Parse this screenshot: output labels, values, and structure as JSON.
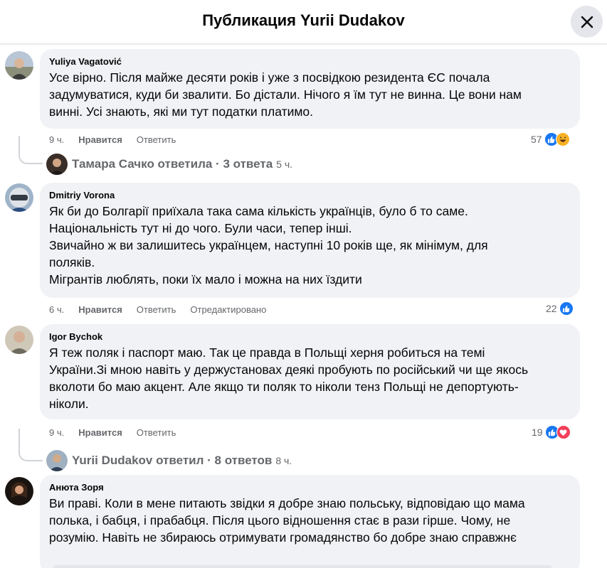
{
  "header": {
    "title": "Публикация Yurii Dudakov",
    "close_icon": "close-icon"
  },
  "comments": [
    {
      "author": "Yuliya Vagatović",
      "text": "Усе вірно. Після майже десяти років і уже з посвідкою резидента ЄС почала\nзадумуватися, куди би звалити. Бо дістали. Нічого я їм тут не винна. Це вони нам\nвинні. Усі знають, які ми тут податки платимо.",
      "time": "9 ч.",
      "like_label": "Нравится",
      "reply_label": "Ответить",
      "edited_label": "",
      "reactions_count": "57",
      "reactions": [
        "like",
        "haha"
      ],
      "replies_summary": "Тамара Сачко ответила · 3 ответа",
      "replies_time": "5 ч."
    },
    {
      "author": "Dmitriy Vorona",
      "text": "Як би до Болгарії приїхала така сама кількість українців, було б то саме.\nНаціональність тут ні до чого. Були часи, тепер інші.\nЗвичайно ж ви залишитесь українцем, наступні 10 років ще, як мінімум, для\nполяків.\nМігрантів люблять, поки їх мало і можна на них їздити",
      "time": "6 ч.",
      "like_label": "Нравится",
      "reply_label": "Ответить",
      "edited_label": "Отредактировано",
      "reactions_count": "22",
      "reactions": [
        "like"
      ]
    },
    {
      "author": "Igor Bychok",
      "text": "Я теж поляк і паспорт маю. Так це правда в Польщі херня робиться на темі\nУкраїни.Зі мною навіть у держустановах деякі пробують по російський чи ще якось\nвколоти бо маю акцент. Але якщо ти поляк то ніколи тенз Польщі не депортують-\nніколи.",
      "time": "9 ч.",
      "like_label": "Нравится",
      "reply_label": "Ответить",
      "edited_label": "",
      "reactions_count": "19",
      "reactions": [
        "like",
        "love"
      ],
      "replies_summary": "Yurii Dudakov ответил · 8 ответов",
      "replies_time": "8 ч."
    },
    {
      "author": "Анюта Зоря",
      "text": "Ви праві. Коли в мене питають звідки я добре знаю польську, відповідаю що мама\nполька, і бабця, і прабабця. Після цього відношення стає в рази гірше. Чому, не\nрозумію. Навіть не збираюсь отримувати громадянство бо добре знаю справжнє"
    }
  ],
  "colors": {
    "bubble_bg": "#f0f2f5",
    "meta_text": "#65676b",
    "like_blue": "#1877f2",
    "love_red": "#f33e58",
    "haha_yellow": "#f7b125"
  }
}
